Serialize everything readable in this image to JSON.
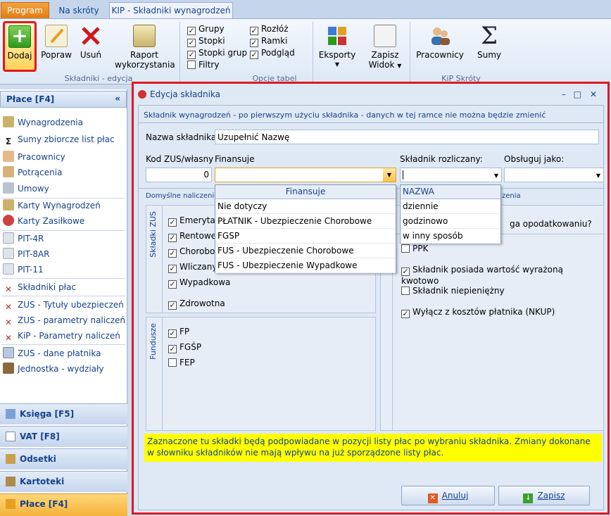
{
  "tabs": {
    "program": "Program",
    "skroty": "Na skróty",
    "kip": "KIP - Składniki wynagrodzeń"
  },
  "ribbon": {
    "dodaj": "Dodaj",
    "popraw": "Popraw",
    "usun": "Usuń",
    "raport_line1": "Raport",
    "raport_line2": "wykorzystania",
    "group_skladniki": "Składniki - edycja",
    "opt_grupy": "Grupy",
    "opt_stopki": "Stopki",
    "opt_stopki_grup": "Stopki grup",
    "opt_filtry": "Filtry",
    "opt_rozloz": "Rozłóż",
    "opt_ramki": "Ramki",
    "opt_podglad": "Podgląd",
    "group_opcje": "Opcje tabel",
    "eksporty": "Eksporty",
    "zapisz_line1": "Zapisz",
    "zapisz_line2": "Widok",
    "pracownicy": "Pracownicy",
    "sumy": "Sumy",
    "group_kip": "KiP Skróty"
  },
  "nav": {
    "header": "Płace [F4]",
    "items": [
      "Wynagrodzenia",
      "Sumy zbiorcze list płac",
      "Pracownicy",
      "Potrącenia",
      "Umowy",
      "Karty Wynagrodzeń",
      "Karty Zasiłkowe",
      "PIT-4R",
      "PIT-8AR",
      "PIT-11",
      "Składniki płac",
      "ZUS - Tytuły ubezpieczeń",
      "ZUS - parametry naliczeń",
      "KiP - Parametry naliczeń",
      "ZUS - dane płatnika",
      "Jednostka - wydziały"
    ],
    "buttons": [
      "Księga [F5]",
      "VAT [F8]",
      "Odsetki",
      "Kartoteki",
      "Płace [F4]"
    ]
  },
  "dialog": {
    "title": "Edycja składnika",
    "hint": "Składnik wynagrodzeń - po pierwszym użyciu składnika - danych w tej ramce nie można będzie zmienić",
    "name_label": "Nazwa składnika",
    "name_value": "Uzupełnić Nazwę",
    "kod_label": "Kod ZUS/własny",
    "kod_value": "0",
    "finansuje_label": "Finansuje",
    "rozliczany_label": "Składnik rozliczany:",
    "obsluguj_label": "Obsługuj jako:",
    "domyslne_label": "Domyślne naliczenie",
    "zenia": "zenia",
    "finansuje_dd": {
      "header": "Finansuje",
      "options": [
        "Nie dotyczy",
        "PŁATNIK - Ubezpieczenie Chorobowe",
        "FGSP",
        "FUS - Ubezpieczenie Chorobowe",
        "FUS - Ubezpieczenie Wypadkowe"
      ]
    },
    "nazwa_dd": {
      "header": "NAZWA",
      "options": [
        "dziennie",
        "godzinowo",
        "w inny sposób"
      ]
    },
    "skladki_zus_label": "Składki ZUS",
    "zus_checks": [
      "Emerytal",
      "Rentowe",
      "Chorobo",
      "Wliczany do podst. wyn. chorob. (PWC)",
      "Wypadkowa",
      "Zdrowotna"
    ],
    "fundusze_label": "Fundusze",
    "fund_checks": [
      {
        "label": "FP",
        "checked": true
      },
      {
        "label": "FGŚP",
        "checked": true
      },
      {
        "label": "FEP",
        "checked": false
      }
    ],
    "opodatk_text": "ga opodatkowaniu?",
    "right_checks": [
      {
        "label": "PPK",
        "checked": false
      },
      {
        "label": "Składnik posiada wartość wyrażoną kwotowo",
        "checked": true
      },
      {
        "label": "Składnik niepieniężny",
        "checked": false
      },
      {
        "label": "Wyłącz z kosztów płatnika (NKUP)",
        "checked": true
      }
    ],
    "info": "Zaznaczone tu składki będą podpowiadane w pozycji listy płac po wybraniu składnika. Zmiany dokonane w słowniku składników nie mają wpływu na już sporządzone listy płac.",
    "cancel": "Anuluj",
    "save": "Zapisz"
  },
  "colors": {
    "highlight": "#e01822",
    "info_bg": "#ffff00",
    "program_tab": "#f09030"
  }
}
